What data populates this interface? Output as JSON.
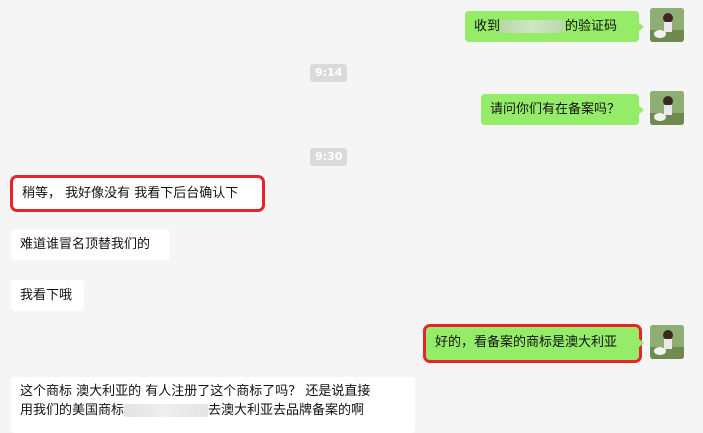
{
  "messages": [
    {
      "side": "me",
      "text_a": "收到",
      "text_b": "的验证码"
    },
    {
      "side": "me",
      "text": "请问你们有在备案吗？"
    },
    {
      "side": "them",
      "text": "稍等， 我好像没有 我看下后台确认下",
      "highlighted": true
    },
    {
      "side": "them",
      "text": "难道谁冒名顶替我们的"
    },
    {
      "side": "them",
      "text": "我看下哦"
    },
    {
      "side": "me",
      "text": "好的，看备案的商标是澳大利亚",
      "highlighted": true
    },
    {
      "side": "them",
      "line1": "这个商标  澳大利亚的 有人注册了这个商标了吗？ 还是说直接",
      "line2_a": "用我们的美国商标",
      "line2_b": "去澳大利亚去品牌备案的啊"
    }
  ],
  "timestamps": [
    "9:14",
    "9:30"
  ],
  "colors": {
    "me_bubble": "#95ec69",
    "them_bubble": "#ffffff",
    "highlight": "#e8242a",
    "background": "#f5f5f5"
  }
}
